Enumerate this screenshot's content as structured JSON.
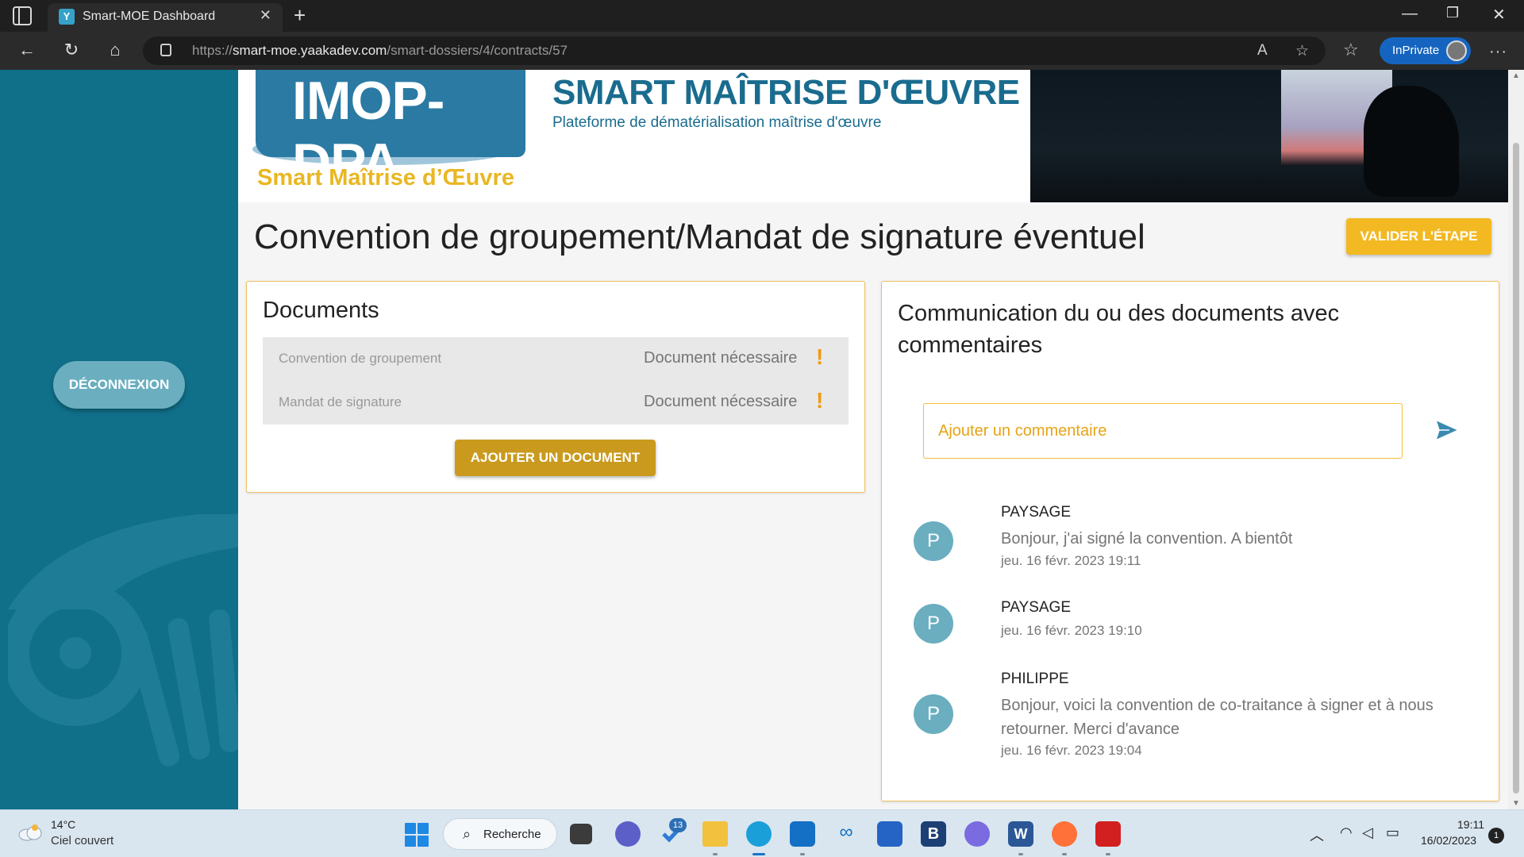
{
  "browser": {
    "tab_title": "Smart-MOE Dashboard",
    "tab_favicon": "Y",
    "url_prefix": "https://",
    "url_domain": "smart-moe.yaakadev.com",
    "url_path": "/smart-dossiers/4/contracts/57",
    "inprivate_label": "InPrivate"
  },
  "sidebar": {
    "logout_label": "DÉCONNEXION"
  },
  "banner": {
    "logo_main": "IMOP-DPA",
    "logo_sub": "Smart Maîtrise d’Œuvre",
    "site_title": "SMART MAÎTRISE D'ŒUVRE",
    "site_subtitle": "Plateforme de dématérialisation maîtrise d'œuvre"
  },
  "page": {
    "title": "Convention de groupement/Mandat de signature éventuel",
    "validate_label": "VALIDER L'ÉTAPE"
  },
  "documents": {
    "title": "Documents",
    "items": [
      {
        "name": "Convention de groupement",
        "status": "Document nécessaire",
        "flag": "!"
      },
      {
        "name": "Mandat de signature",
        "status": "Document nécessaire",
        "flag": "!"
      }
    ],
    "add_label": "AJOUTER UN DOCUMENT"
  },
  "communication": {
    "title": "Communication du ou des documents avec commentaires",
    "input_placeholder": "Ajouter un commentaire",
    "input_value": "",
    "comments": [
      {
        "initial": "P",
        "author": "PAYSAGE",
        "text": "Bonjour, j'ai signé la convention. A bientôt",
        "date": "jeu. 16 févr. 2023 19:11"
      },
      {
        "initial": "P",
        "author": "PAYSAGE",
        "text": "",
        "date": "jeu. 16 févr. 2023 19:10"
      },
      {
        "initial": "P",
        "author": "PHILIPPE",
        "text": "Bonjour, voici la convention de co-traitance à signer et à nous retourner. Merci d'avance",
        "date": "jeu. 16 févr. 2023 19:04"
      }
    ]
  },
  "taskbar": {
    "weather_temp": "14°C",
    "weather_desc": "Ciel couvert",
    "search_label": "Recherche",
    "badge_count": "13",
    "time": "19:11",
    "date": "16/02/2023",
    "notifications": "1"
  },
  "colors": {
    "sidebar": "#10708a",
    "accent_yellow": "#f3b922",
    "brand_blue": "#1a6c8f"
  }
}
